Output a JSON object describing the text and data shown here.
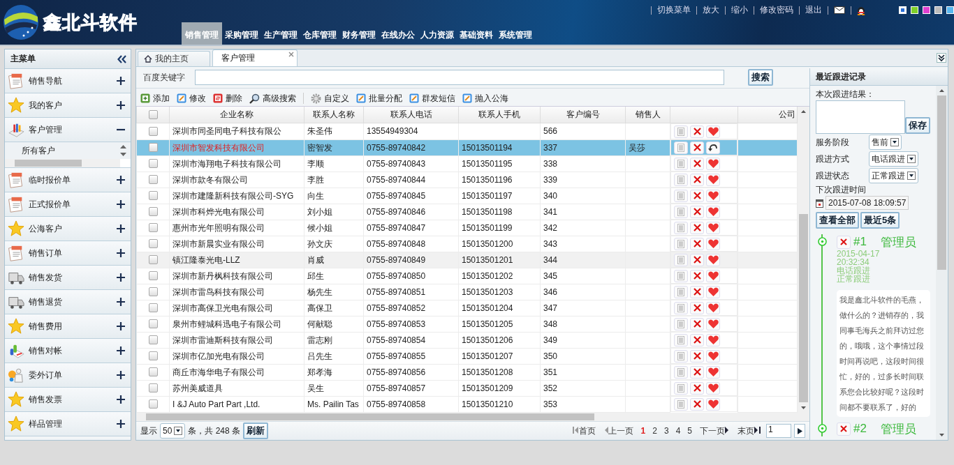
{
  "header": {
    "logo_text": "鑫北斗软件",
    "nav": [
      {
        "label": "销售管理",
        "selected": true
      },
      {
        "label": "采购管理",
        "selected": false
      },
      {
        "label": "生产管理",
        "selected": false
      },
      {
        "label": "仓库管理",
        "selected": false
      },
      {
        "label": "财务管理",
        "selected": false
      },
      {
        "label": "在线办公",
        "selected": false
      },
      {
        "label": "人力资源",
        "selected": false
      },
      {
        "label": "基础资料",
        "selected": false
      },
      {
        "label": "系统管理",
        "selected": false
      }
    ],
    "links": [
      "切换菜单",
      "放大",
      "缩小",
      "修改密码",
      "退出"
    ],
    "themes": [
      {
        "color": "#2a6fd6",
        "selected": true
      },
      {
        "color": "#7fd02a",
        "selected": false
      },
      {
        "color": "#e040d0",
        "selected": false
      },
      {
        "color": "#bcbcbc",
        "selected": false
      },
      {
        "color": "#5ab8f0",
        "selected": false
      }
    ]
  },
  "sidebar": {
    "title": "主菜单",
    "items": [
      {
        "label": "销售导航",
        "kind": "doc",
        "expanded": false
      },
      {
        "label": "我的客户",
        "kind": "star",
        "expanded": false
      },
      {
        "label": "客户管理",
        "kind": "tools",
        "expanded": true,
        "children": [
          {
            "label": "所有客户"
          }
        ]
      },
      {
        "label": "临时报价单",
        "kind": "doc",
        "expanded": false
      },
      {
        "label": "正式报价单",
        "kind": "doc",
        "expanded": false
      },
      {
        "label": "公海客户",
        "kind": "star",
        "expanded": false
      },
      {
        "label": "销售订单",
        "kind": "doc",
        "expanded": false
      },
      {
        "label": "销售发货",
        "kind": "truck",
        "expanded": false
      },
      {
        "label": "销售退货",
        "kind": "truck",
        "expanded": false
      },
      {
        "label": "销售费用",
        "kind": "star",
        "expanded": false
      },
      {
        "label": "销售对帐",
        "kind": "chart",
        "expanded": false
      },
      {
        "label": "委外订单",
        "kind": "people",
        "expanded": false
      },
      {
        "label": "销售发票",
        "kind": "star",
        "expanded": false
      },
      {
        "label": "样品管理",
        "kind": "star",
        "expanded": false
      }
    ]
  },
  "tabs": [
    {
      "label": "我的主页",
      "kind": "home",
      "selected": false
    },
    {
      "label": "客户管理",
      "kind": "closable",
      "selected": true
    }
  ],
  "search": {
    "label": "百度关键字",
    "button": "搜索"
  },
  "toolbar": [
    {
      "label": "添加",
      "kind": "add"
    },
    {
      "label": "修改",
      "kind": "edit"
    },
    {
      "label": "删除",
      "kind": "delete"
    },
    {
      "label": "高级搜索",
      "kind": "search"
    },
    {
      "label": "自定义",
      "kind": "gear"
    },
    {
      "label": "批量分配",
      "kind": "edit"
    },
    {
      "label": "群发短信",
      "kind": "edit"
    },
    {
      "label": "抛入公海",
      "kind": "edit"
    }
  ],
  "table": {
    "all_checked": false,
    "columns": [
      "企业名称",
      "联系人名称",
      "联系人电话",
      "联系人手机",
      "客户编号",
      "销售人",
      "公司"
    ],
    "rows": [
      {
        "company": "深圳市同圣同电子科技有限公",
        "contact": "朱圣伟",
        "phone": "13554949304",
        "mobile": "",
        "code": "566",
        "salesperson": "",
        "checked": false,
        "selected": false,
        "hovered": false
      },
      {
        "company": "深圳市智发科技有限公司",
        "contact": "密智发",
        "phone": "0755-89740842",
        "mobile": "15013501194",
        "code": "337",
        "salesperson": "吴莎",
        "checked": false,
        "selected": true,
        "hovered": false
      },
      {
        "company": "深圳市海翔电子科技有限公司",
        "contact": "李顺",
        "phone": "0755-89740843",
        "mobile": "15013501195",
        "code": "338",
        "salesperson": "",
        "checked": false,
        "selected": false,
        "hovered": false
      },
      {
        "company": "深圳市款冬有限公司",
        "contact": "李胜",
        "phone": "0755-89740844",
        "mobile": "15013501196",
        "code": "339",
        "salesperson": "",
        "checked": false,
        "selected": false,
        "hovered": false
      },
      {
        "company": "深圳市建隆新科技有限公司-SYG",
        "contact": "向生",
        "phone": "0755-89740845",
        "mobile": "15013501197",
        "code": "340",
        "salesperson": "",
        "checked": false,
        "selected": false,
        "hovered": false
      },
      {
        "company": "深圳市科烨光电有限公司",
        "contact": "刘小姐",
        "phone": "0755-89740846",
        "mobile": "15013501198",
        "code": "341",
        "salesperson": "",
        "checked": false,
        "selected": false,
        "hovered": false
      },
      {
        "company": "惠州市光年照明有限公司",
        "contact": "候小姐",
        "phone": "0755-89740847",
        "mobile": "15013501199",
        "code": "342",
        "salesperson": "",
        "checked": false,
        "selected": false,
        "hovered": false
      },
      {
        "company": "深圳市新晨实业有限公司",
        "contact": "孙文庆",
        "phone": "0755-89740848",
        "mobile": "15013501200",
        "code": "343",
        "salesperson": "",
        "checked": false,
        "selected": false,
        "hovered": false
      },
      {
        "company": "镇江隆泰光电-LLZ",
        "contact": "肖威",
        "phone": "0755-89740849",
        "mobile": "15013501201",
        "code": "344",
        "salesperson": "",
        "checked": false,
        "selected": false,
        "hovered": true
      },
      {
        "company": "深圳市新丹枫科技有限公司",
        "contact": "邱生",
        "phone": "0755-89740850",
        "mobile": "15013501202",
        "code": "345",
        "salesperson": "",
        "checked": false,
        "selected": false,
        "hovered": false
      },
      {
        "company": "深圳市雷鸟科技有限公司",
        "contact": "杨先生",
        "phone": "0755-89740851",
        "mobile": "15013501203",
        "code": "346",
        "salesperson": "",
        "checked": false,
        "selected": false,
        "hovered": false
      },
      {
        "company": "深圳市高保卫光电有限公司",
        "contact": "高保卫",
        "phone": "0755-89740852",
        "mobile": "15013501204",
        "code": "347",
        "salesperson": "",
        "checked": false,
        "selected": false,
        "hovered": false
      },
      {
        "company": "泉州市鲤城科迅电子有限公司",
        "contact": "何献聪",
        "phone": "0755-89740853",
        "mobile": "15013501205",
        "code": "348",
        "salesperson": "",
        "checked": false,
        "selected": false,
        "hovered": false
      },
      {
        "company": "深圳市雷迪斯科技有限公司",
        "contact": "雷志刚",
        "phone": "0755-89740854",
        "mobile": "15013501206",
        "code": "349",
        "salesperson": "",
        "checked": false,
        "selected": false,
        "hovered": false
      },
      {
        "company": "深圳市亿加光电有限公司",
        "contact": "吕先生",
        "phone": "0755-89740855",
        "mobile": "15013501207",
        "code": "350",
        "salesperson": "",
        "checked": false,
        "selected": false,
        "hovered": false
      },
      {
        "company": "商丘市海华电子有限公司",
        "contact": "郑孝海",
        "phone": "0755-89740856",
        "mobile": "15013501208",
        "code": "351",
        "salesperson": "",
        "checked": false,
        "selected": false,
        "hovered": false
      },
      {
        "company": "苏州美威道具",
        "contact": "吴生",
        "phone": "0755-89740857",
        "mobile": "15013501209",
        "code": "352",
        "salesperson": "",
        "checked": false,
        "selected": false,
        "hovered": false
      },
      {
        "company": "I &J Auto Part Part ,Ltd.",
        "contact": "Ms. Pailin Tas",
        "phone": "0755-89740858",
        "mobile": "15013501210",
        "code": "353",
        "salesperson": "",
        "checked": false,
        "selected": false,
        "hovered": false
      }
    ]
  },
  "pagination": {
    "show_label": "显示",
    "page_size": "50",
    "total_text": "条，共 248 条",
    "refresh": "刷新",
    "first": "首页",
    "prev": "上一页",
    "pages": [
      {
        "label": "1",
        "selected": true
      },
      {
        "label": "2",
        "selected": false
      },
      {
        "label": "3",
        "selected": false
      },
      {
        "label": "4",
        "selected": false
      },
      {
        "label": "5",
        "selected": false
      }
    ],
    "next": "下一页",
    "last": "末页",
    "page_input": "1"
  },
  "follow_up": {
    "title": "最近跟进记录",
    "result_label": "本次跟进结果：",
    "save": "保存",
    "fields": [
      {
        "label": "服务阶段",
        "value": "售前"
      },
      {
        "label": "跟进方式",
        "value": "电话跟进"
      },
      {
        "label": "跟进状态",
        "value": "正常跟进"
      }
    ],
    "next_time_label": "下次跟进时间",
    "next_time": "2015-07-08 18:09:57",
    "view_all": "查看全部",
    "recent": "最近5条",
    "entries": [
      {
        "number": "#1",
        "author": "管理员",
        "date": "2015-04-17",
        "time": "20:32:34",
        "method": "电话跟进",
        "status": "正常跟进",
        "note": "我是鑫北斗软件的毛燕，做什么的？进销存的，我同事毛海兵之前拜访过您的，哦哦，这个事情过段时间再说吧，这段时间很忙，好的，过多长时间联系您会比较好呢？这段时间都不要联系了，好的"
      },
      {
        "number": "#2",
        "author": "管理员"
      }
    ]
  }
}
